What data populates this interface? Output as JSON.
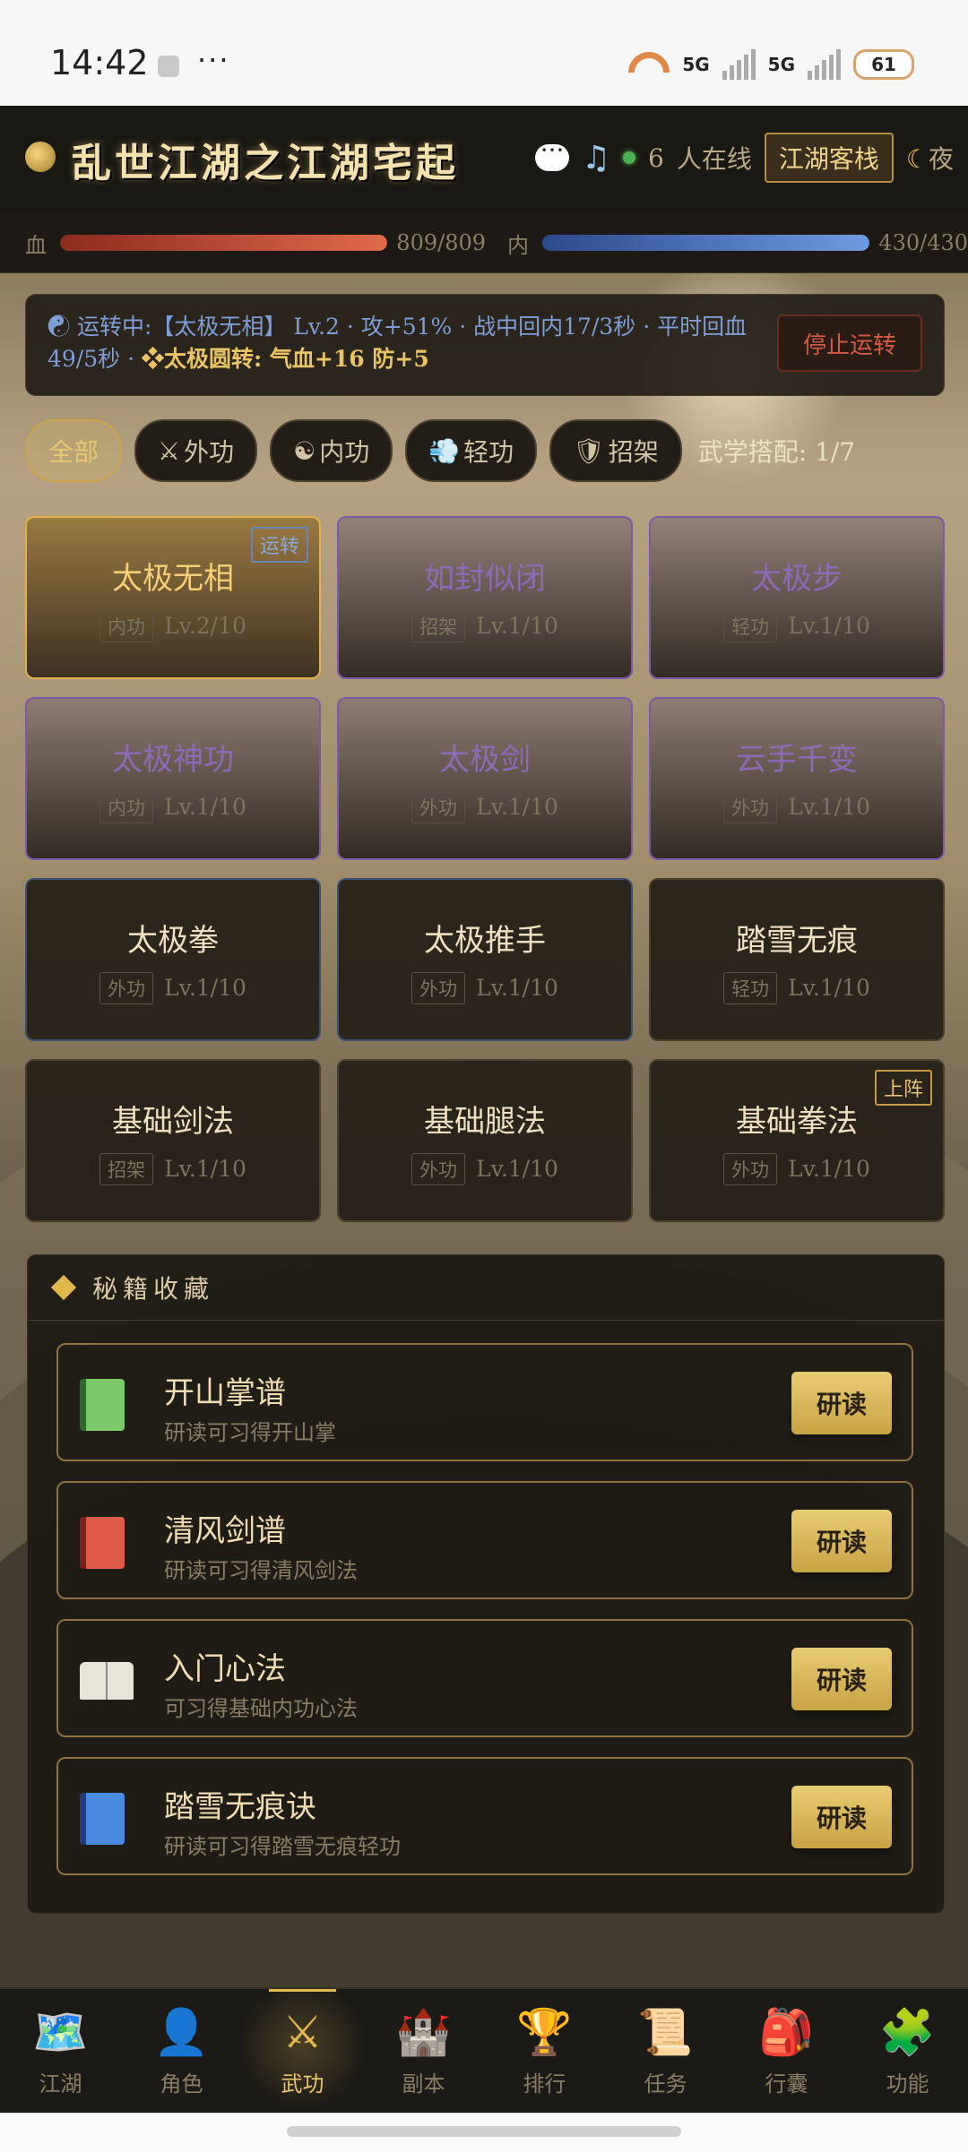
{
  "status_bar": {
    "time": "14:42",
    "dots": "···",
    "net1": "5G",
    "net2": "5G",
    "battery": "61"
  },
  "header": {
    "title": "乱世江湖之江湖宅起",
    "online_count": "6",
    "online_label": "人在线",
    "inn_label": "江湖客栈",
    "night_label": "夜"
  },
  "resources": {
    "hp_label": "血",
    "hp_value": "809/809",
    "hp_ratio": 1.0,
    "mp_label": "内",
    "mp_value": "430/430",
    "mp_ratio": 1.0
  },
  "banner": {
    "line1": "运转中:【太极无相】 Lv.2 · 攻+51% · 战中回内17/3秒 · 平时回血",
    "line2_prefix": "49/5秒 · ",
    "bonus": "太极圆转: 气血+16 防+5",
    "stop_label": "停止运转"
  },
  "filters": {
    "items": [
      {
        "label": "全部",
        "icon": ""
      },
      {
        "label": "外功",
        "icon": "⚔"
      },
      {
        "label": "内功",
        "icon": "☯"
      },
      {
        "label": "轻功",
        "icon": "💨"
      },
      {
        "label": "招架",
        "icon": "🛡"
      }
    ],
    "match_label": "武学搭配: 1/7"
  },
  "skills": [
    {
      "name": "太极无相",
      "type": "内功",
      "level": "Lv.2/10",
      "badge": "运转"
    },
    {
      "name": "如封似闭",
      "type": "招架",
      "level": "Lv.1/10"
    },
    {
      "name": "太极步",
      "type": "轻功",
      "level": "Lv.1/10"
    },
    {
      "name": "太极神功",
      "type": "内功",
      "level": "Lv.1/10"
    },
    {
      "name": "太极剑",
      "type": "外功",
      "level": "Lv.1/10"
    },
    {
      "name": "云手千变",
      "type": "外功",
      "level": "Lv.1/10"
    },
    {
      "name": "太极拳",
      "type": "外功",
      "level": "Lv.1/10"
    },
    {
      "name": "太极推手",
      "type": "外功",
      "level": "Lv.1/10"
    },
    {
      "name": "踏雪无痕",
      "type": "轻功",
      "level": "Lv.1/10"
    },
    {
      "name": "基础剑法",
      "type": "招架",
      "level": "Lv.1/10"
    },
    {
      "name": "基础腿法",
      "type": "外功",
      "level": "Lv.1/10"
    },
    {
      "name": "基础拳法",
      "type": "外功",
      "level": "Lv.1/10",
      "badge": "上阵"
    }
  ],
  "books": {
    "title": "秘籍收藏",
    "read_label": "研读",
    "items": [
      {
        "name": "开山掌谱",
        "desc": "研读可习得开山掌",
        "icon": "green-book-icon"
      },
      {
        "name": "清风剑谱",
        "desc": "研读可习得清风剑法",
        "icon": "red-book-icon"
      },
      {
        "name": "入门心法",
        "desc": "可习得基础内功心法",
        "icon": "open-book-icon"
      },
      {
        "name": "踏雪无痕诀",
        "desc": "研读可习得踏雪无痕轻功",
        "icon": "blue-book-icon"
      }
    ]
  },
  "nav": [
    {
      "label": "江湖",
      "icon": "🗺️"
    },
    {
      "label": "角色",
      "icon": "👤"
    },
    {
      "label": "武功",
      "icon": "⚔"
    },
    {
      "label": "副本",
      "icon": "🏰"
    },
    {
      "label": "排行",
      "icon": "🏆"
    },
    {
      "label": "任务",
      "icon": "📜"
    },
    {
      "label": "行囊",
      "icon": "🎒"
    },
    {
      "label": "功能",
      "icon": "🧩"
    }
  ]
}
